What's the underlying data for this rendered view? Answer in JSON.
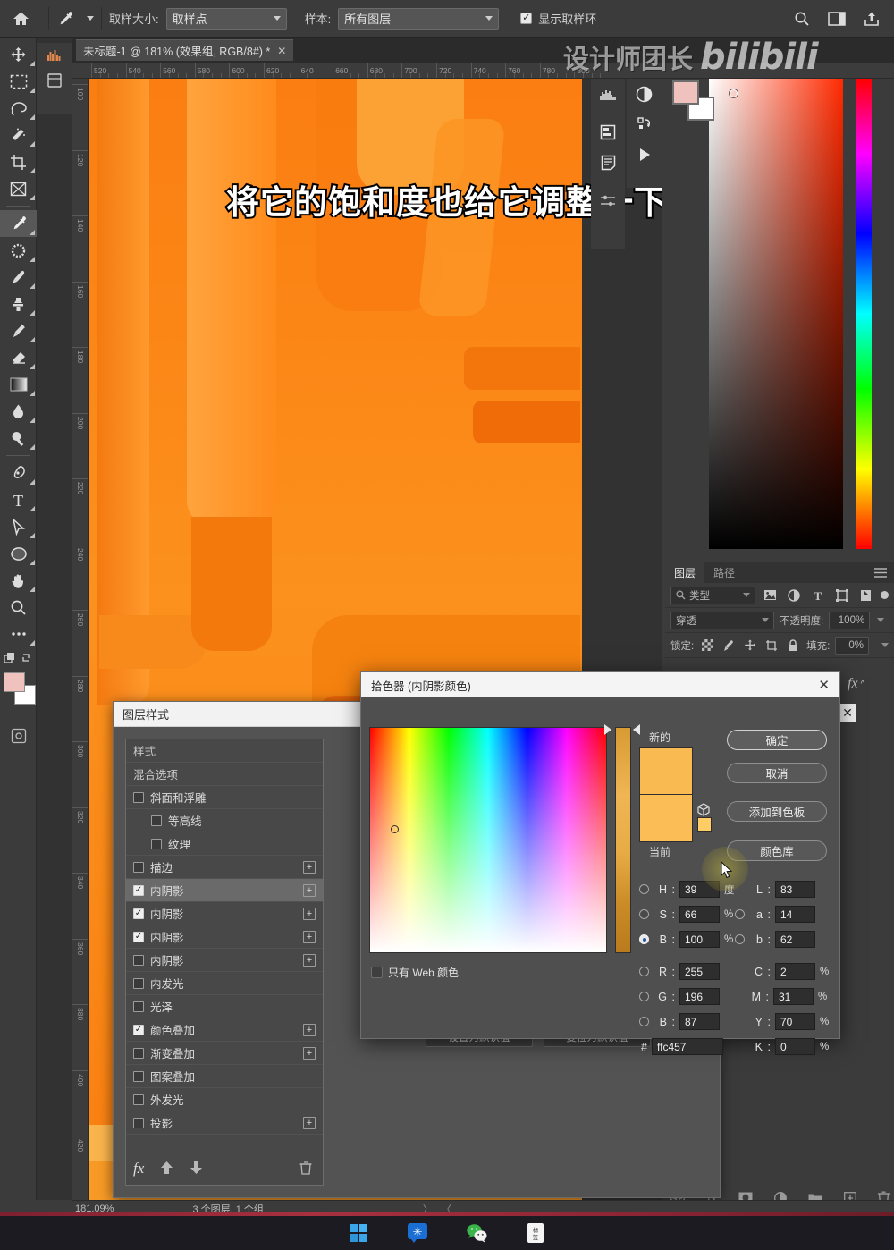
{
  "app": "Adobe Photoshop",
  "options_bar": {
    "home_icon": "home-icon",
    "tool_icon": "eyedropper-icon",
    "sample_size_label": "取样大小:",
    "sample_size_value": "取样点",
    "sample_label": "样本:",
    "sample_value": "所有图层",
    "show_ring_label": "显示取样环",
    "show_ring_checked": true,
    "search_icon": "search-icon",
    "workspace_icon": "workspace-icon",
    "share_icon": "share-icon"
  },
  "document": {
    "tab_title": "未标题-1 @ 181% (效果组, RGB/8#) *",
    "close_icon": "close-icon"
  },
  "rulers": {
    "horizontal": [
      "520",
      "540",
      "560",
      "580",
      "600",
      "620",
      "640",
      "660",
      "680",
      "700",
      "720",
      "740",
      "760",
      "780",
      "800"
    ],
    "vertical": [
      "100",
      "120",
      "140",
      "160",
      "180",
      "200",
      "220",
      "240",
      "260",
      "280",
      "300",
      "320",
      "340",
      "360",
      "380",
      "400",
      "420"
    ]
  },
  "caption": {
    "text": "将它的饱和度也给它调整一下"
  },
  "watermark": {
    "zh": "设计师团长",
    "brand": "bilibili"
  },
  "toolbar": {
    "tools": [
      {
        "name": "move-tool",
        "icon": "move-icon"
      },
      {
        "name": "marquee-tool",
        "icon": "rect-marquee-icon"
      },
      {
        "name": "lasso-tool",
        "icon": "lasso-icon"
      },
      {
        "name": "quick-select-tool",
        "icon": "magic-wand-icon"
      },
      {
        "name": "crop-tool",
        "icon": "crop-icon"
      },
      {
        "name": "frame-tool",
        "icon": "frame-icon"
      },
      {
        "name": "eyedropper-tool",
        "icon": "eyedropper-icon",
        "selected": true
      },
      {
        "name": "healing-brush-tool",
        "icon": "spot-healing-icon"
      },
      {
        "name": "brush-tool",
        "icon": "brush-icon"
      },
      {
        "name": "clone-stamp-tool",
        "icon": "stamp-icon"
      },
      {
        "name": "history-brush-tool",
        "icon": "history-brush-icon"
      },
      {
        "name": "eraser-tool",
        "icon": "eraser-icon"
      },
      {
        "name": "gradient-tool",
        "icon": "gradient-icon"
      },
      {
        "name": "blur-tool",
        "icon": "waterdrop-icon"
      },
      {
        "name": "dodge-tool",
        "icon": "dodge-icon"
      },
      {
        "name": "pen-tool",
        "icon": "pen-icon"
      },
      {
        "name": "type-tool",
        "icon": "type-icon"
      },
      {
        "name": "path-selection-tool",
        "icon": "arrow-pointer-icon"
      },
      {
        "name": "ellipse-tool",
        "icon": "ellipse-icon"
      },
      {
        "name": "hand-tool",
        "icon": "hand-icon"
      },
      {
        "name": "zoom-tool",
        "icon": "magnifier-icon"
      },
      {
        "name": "more-tools",
        "icon": "ellipsis-icon"
      },
      {
        "name": "edit-toolbar",
        "icon": "quick-mask-icon"
      }
    ],
    "foreground_color": "#f0c2bd",
    "background_color": "#ffffff"
  },
  "color_panel": {
    "sv_marker": "sv-marker"
  },
  "layers_panel": {
    "tabs": [
      {
        "label": "图层",
        "active": true
      },
      {
        "label": "路径",
        "active": false
      }
    ],
    "menu_icon": "panel-menu-icon",
    "filter_placeholder": "类型",
    "filter_icons": [
      "pixel-filter-icon",
      "adjustment-filter-icon",
      "type-filter-icon",
      "shape-filter-icon",
      "smart-filter-icon"
    ],
    "blend_mode": "穿透",
    "opacity_label": "不透明度:",
    "opacity_value": "100%",
    "lock_label": "锁定:",
    "lock_icons": [
      "lock-transparent-icon",
      "lock-image-icon",
      "lock-position-icon",
      "lock-artboard-icon",
      "lock-all-icon"
    ],
    "fill_label": "填充:",
    "fill_value": "0%",
    "bottom_icons": [
      "link-icon",
      "fx-icon",
      "mask-icon",
      "adjustment-icon",
      "group-icon",
      "new-layer-icon",
      "delete-icon"
    ],
    "fx_expand": "fx-collapse-icon",
    "close_icon": "close-icon"
  },
  "layer_style_dialog": {
    "title": "图层样式",
    "items": [
      {
        "label": "样式",
        "type": "header"
      },
      {
        "label": "混合选项",
        "type": "header"
      },
      {
        "label": "斜面和浮雕",
        "checked": false,
        "indent": 0,
        "plus": false
      },
      {
        "label": "等高线",
        "checked": false,
        "indent": 1,
        "plus": false
      },
      {
        "label": "纹理",
        "checked": false,
        "indent": 1,
        "plus": false
      },
      {
        "label": "描边",
        "checked": false,
        "indent": 0,
        "plus": true
      },
      {
        "label": "内阴影",
        "checked": true,
        "indent": 0,
        "plus": true,
        "selected": true
      },
      {
        "label": "内阴影",
        "checked": true,
        "indent": 0,
        "plus": true
      },
      {
        "label": "内阴影",
        "checked": true,
        "indent": 0,
        "plus": true
      },
      {
        "label": "内阴影",
        "checked": false,
        "indent": 0,
        "plus": true
      },
      {
        "label": "内发光",
        "checked": false,
        "indent": 0,
        "plus": false
      },
      {
        "label": "光泽",
        "checked": false,
        "indent": 0,
        "plus": false
      },
      {
        "label": "颜色叠加",
        "checked": true,
        "indent": 0,
        "plus": true
      },
      {
        "label": "渐变叠加",
        "checked": false,
        "indent": 0,
        "plus": true
      },
      {
        "label": "图案叠加",
        "checked": false,
        "indent": 0,
        "plus": false
      },
      {
        "label": "外发光",
        "checked": false,
        "indent": 0,
        "plus": false
      },
      {
        "label": "投影",
        "checked": false,
        "indent": 0,
        "plus": true
      }
    ],
    "footer_icons": [
      "fx-icon",
      "move-up-icon",
      "move-down-icon",
      "trash-icon"
    ],
    "set_default_label": "设置为默认值",
    "reset_default_label": "复位为默认值",
    "close_icon": "close-icon"
  },
  "color_picker": {
    "title": "拾色器 (内阴影颜色)",
    "close_icon": "close-icon",
    "new_label": "新的",
    "current_label": "当前",
    "new_color": "#f9ba51",
    "current_color": "#fbbd55",
    "web_safe_swatch": "#ffcc66",
    "cube_icon": "out-of-gamut-icon",
    "buttons": {
      "ok": "确定",
      "cancel": "取消",
      "add_swatch": "添加到色板",
      "color_library": "颜色库"
    },
    "web_only_label": "只有 Web 颜色",
    "web_only_checked": false,
    "fields": [
      {
        "key": "H",
        "value": "39",
        "unit": "度",
        "radio": false
      },
      {
        "key": "S",
        "value": "66",
        "unit": "%",
        "radio": false
      },
      {
        "key": "B",
        "value": "100",
        "unit": "%",
        "radio": true
      },
      {
        "key": "R",
        "value": "255",
        "unit": "",
        "radio": false
      },
      {
        "key": "G",
        "value": "196",
        "unit": "",
        "radio": false
      },
      {
        "key": "B2",
        "label": "B",
        "value": "87",
        "unit": "",
        "radio": false
      }
    ],
    "lab_fields": [
      {
        "key": "L",
        "value": "83",
        "unit": "",
        "radio": false
      },
      {
        "key": "a",
        "value": "14",
        "unit": "",
        "radio": false
      },
      {
        "key": "b",
        "value": "62",
        "unit": "",
        "radio": false
      }
    ],
    "cmyk_fields": [
      {
        "key": "C",
        "value": "2",
        "unit": "%"
      },
      {
        "key": "M",
        "value": "31",
        "unit": "%"
      },
      {
        "key": "Y",
        "value": "70",
        "unit": "%"
      },
      {
        "key": "K",
        "value": "0",
        "unit": "%"
      }
    ],
    "hex_symbol": "#",
    "hex_value": "ffc457"
  },
  "status_bar": {
    "zoom": "181.09%",
    "doc_info": "3 个图层, 1 个组",
    "next_icon": "chevron-right-icon",
    "prev_icon": "chevron-left-icon"
  },
  "taskbar": {
    "items": [
      {
        "name": "windows-start-icon",
        "label": ""
      },
      {
        "name": "app-blue-icon",
        "label": ""
      },
      {
        "name": "wechat-icon",
        "label": ""
      },
      {
        "name": "notes-app-icon",
        "label": "标签"
      }
    ]
  },
  "colors": {
    "panel_bg": "#3b3b3b",
    "dialog_bg": "#535353",
    "accent_orange": "#fb8a18"
  }
}
